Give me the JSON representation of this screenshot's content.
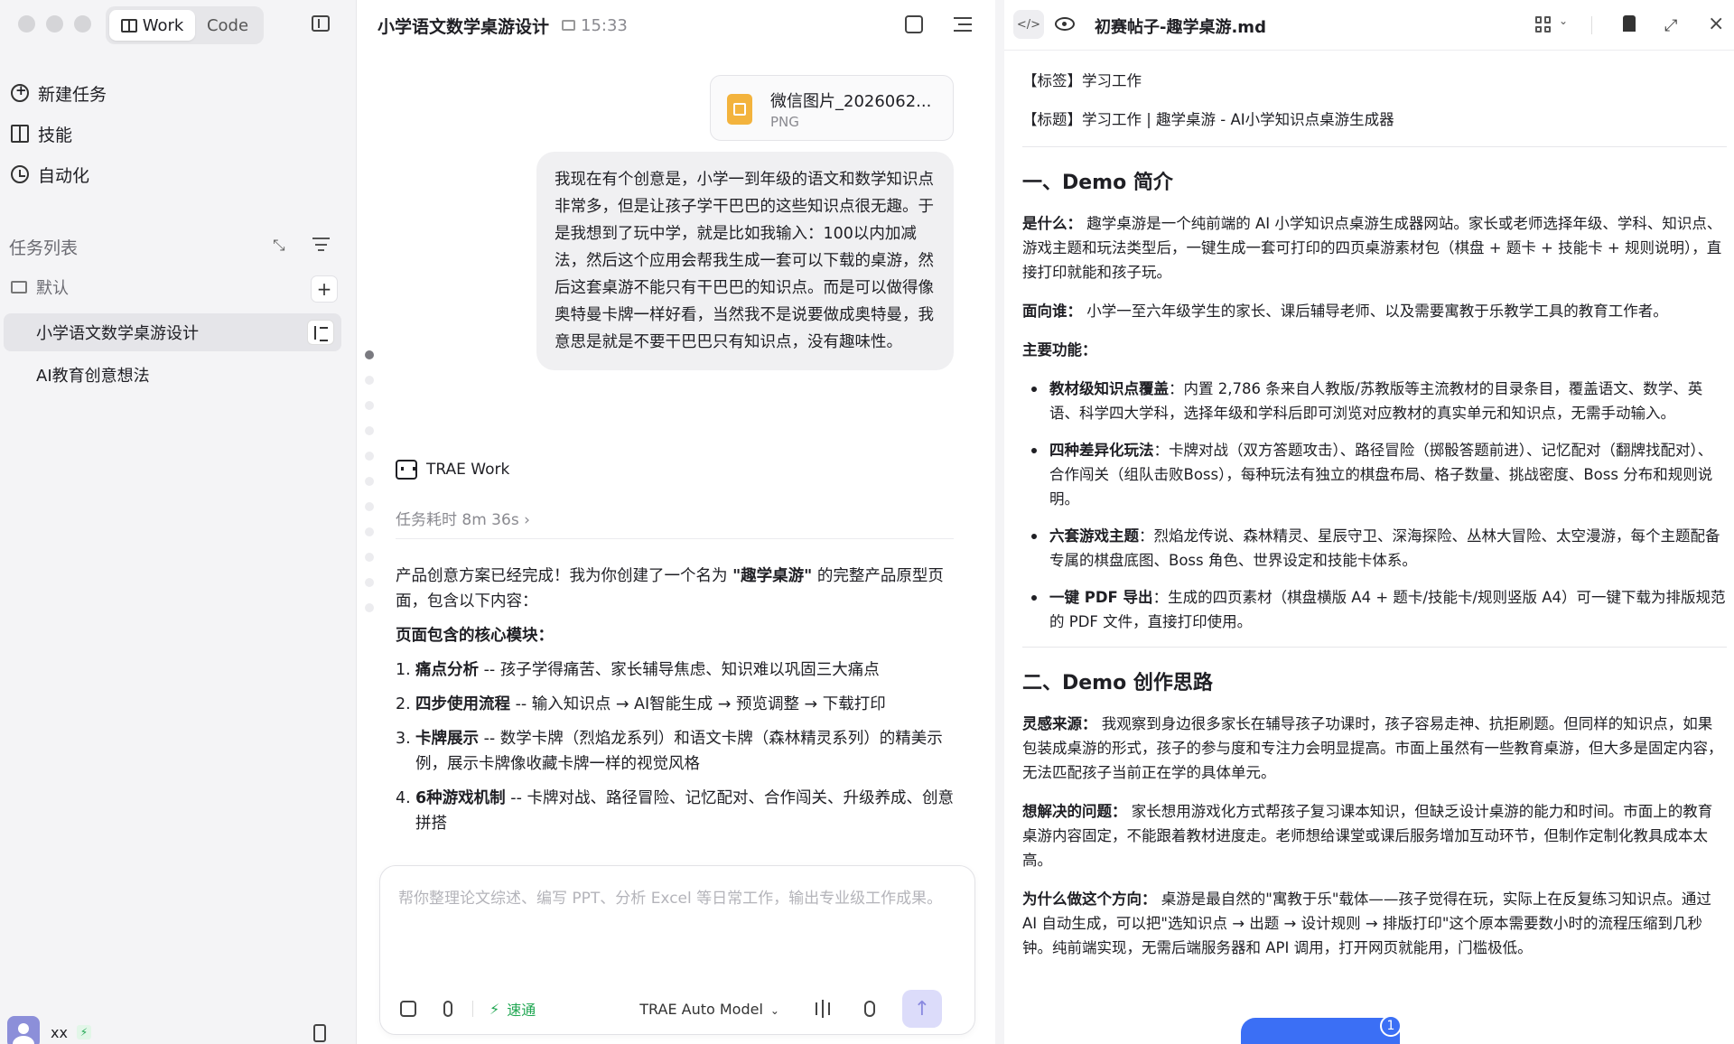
{
  "sidebar": {
    "mode_work": "Work",
    "mode_code": "Code",
    "nav": {
      "new_task": "新建任务",
      "skills": "技能",
      "automation": "自动化"
    },
    "task_list_label": "任务列表",
    "folder_default": "默认",
    "tasks": [
      "小学语文数学桌游设计",
      "AI教育创意想法"
    ],
    "user_name": "xx",
    "collapse_glyph": "⤡",
    "add_glyph": "+"
  },
  "chat": {
    "title": "小学语文数学桌游设计",
    "time": "15:33",
    "attachment": {
      "name": "微信图片_2026062...",
      "type": "PNG"
    },
    "user_message": "我现在有个创意是，小学一到年级的语文和数学知识点非常多，但是让孩子学干巴巴的这些知识点很无趣。于是我想到了玩中学，就是比如我输入：100以内加减法，然后这个应用会帮我生成一套可以下载的桌游，然后这套桌游不能只有干巴巴的知识点。而是可以做得像奥特曼卡牌一样好看，当然我不是说要做成奥特曼，我意思是就是不要干巴巴只有知识点，没有趣味性。",
    "agent_name": "TRAE Work",
    "duration": "任务耗时 8m 36s ›",
    "answer": {
      "intro_a": "产品创意方案已经完成！我为你创建了一个名为 ",
      "intro_b": "\"趣学桌游\"",
      "intro_c": " 的完整产品原型页面，包含以下内容：",
      "modules_heading": "页面包含的核心模块：",
      "items": [
        {
          "num": "1.",
          "title": "痛点分析",
          "text": " -- 孩子学得痛苦、家长辅导焦虑、知识难以巩固三大痛点"
        },
        {
          "num": "2.",
          "title": "四步使用流程",
          "text": " -- 输入知识点 → AI智能生成 → 预览调整 → 下载打印"
        },
        {
          "num": "3.",
          "title": "卡牌展示",
          "text": " -- 数学卡牌（烈焰龙系列）和语文卡牌（森林精灵系列）的精美示例，展示卡牌像收藏卡牌一样的视觉风格"
        },
        {
          "num": "4.",
          "title": "6种游戏机制",
          "text": " -- 卡牌对战、路径冒险、记忆配对、合作闯关、升级养成、创意拼搭"
        }
      ]
    },
    "composer": {
      "placeholder": "帮你整理论文综述、编写 PPT、分析 Excel 等日常工作，输出专业级工作成果。",
      "speed_label": "速通",
      "model_label": "TRAE Auto Model",
      "send_glyph": "↑"
    }
  },
  "doc": {
    "title": "初赛帖子-趣学桌游.md",
    "code_glyph": "</>",
    "tag_line": "【标签】学习工作",
    "title_line": "【标题】学习工作 | 趣学桌游 - AI小学知识点桌游生成器",
    "s1_heading": "一、Demo 简介",
    "what_label": "是什么：",
    "what_text": " 趣学桌游是一个纯前端的 AI 小学知识点桌游生成器网站。家长或老师选择年级、学科、知识点、游戏主题和玩法类型后，一键生成一套可打印的四页桌游素材包（棋盘 + 题卡 + 技能卡 + 规则说明），直接打印就能和孩子玩。",
    "who_label": "面向谁：",
    "who_text": " 小学一至六年级学生的家长、课后辅导老师、以及需要寓教于乐教学工具的教育工作者。",
    "features_label": "主要功能：",
    "features": [
      {
        "title": "教材级知识点覆盖",
        "text": "：内置 2,786 条来自人教版/苏教版等主流教材的目录条目，覆盖语文、数学、英语、科学四大学科，选择年级和学科后即可浏览对应教材的真实单元和知识点，无需手动输入。"
      },
      {
        "title": "四种差异化玩法",
        "text": "：卡牌对战（双方答题攻击）、路径冒险（掷骰答题前进）、记忆配对（翻牌找配对）、合作闯关（组队击败Boss），每种玩法有独立的棋盘布局、格子数量、挑战密度、Boss 分布和规则说明。"
      },
      {
        "title": "六套游戏主题",
        "text": "：烈焰龙传说、森林精灵、星辰守卫、深海探险、丛林大冒险、太空漫游，每个主题配备专属的棋盘底图、Boss 角色、世界设定和技能卡体系。"
      },
      {
        "title": "一键 PDF 导出",
        "text": "：生成的四页素材（棋盘横版 A4 + 题卡/技能卡/规则竖版 A4）可一键下载为排版规范的 PDF 文件，直接打印使用。"
      }
    ],
    "s2_heading": "二、Demo 创作思路",
    "inspiration_label": "灵感来源：",
    "inspiration_text": " 我观察到身边很多家长在辅导孩子功课时，孩子容易走神、抗拒刷题。但同样的知识点，如果包装成桌游的形式，孩子的参与度和专注力会明显提高。市面上虽然有一些教育桌游，但大多是固定内容，无法匹配孩子当前正在学的具体单元。",
    "problem_label": "想解决的问题：",
    "problem_text": " 家长想用游戏化方式帮孩子复习课本知识，但缺乏设计桌游的能力和时间。市面上的教育桌游内容固定，不能跟着教材进度走。老师想给课堂或课后服务增加互动环节，但制作定制化教具成本太高。",
    "why_label": "为什么做这个方向：",
    "why_text": " 桌游是最自然的\"寓教于乐\"载体——孩子觉得在玩，实际上在反复练习知识点。通过 AI 自动生成，可以把\"选知识点 → 出题 → 设计规则 → 排版打印\"这个原本需要数小时的流程压缩到几秒钟。纯前端实现，无需后端服务器和 API 调用，打开网页就能用，门槛极低。",
    "toast_badge": "1"
  }
}
